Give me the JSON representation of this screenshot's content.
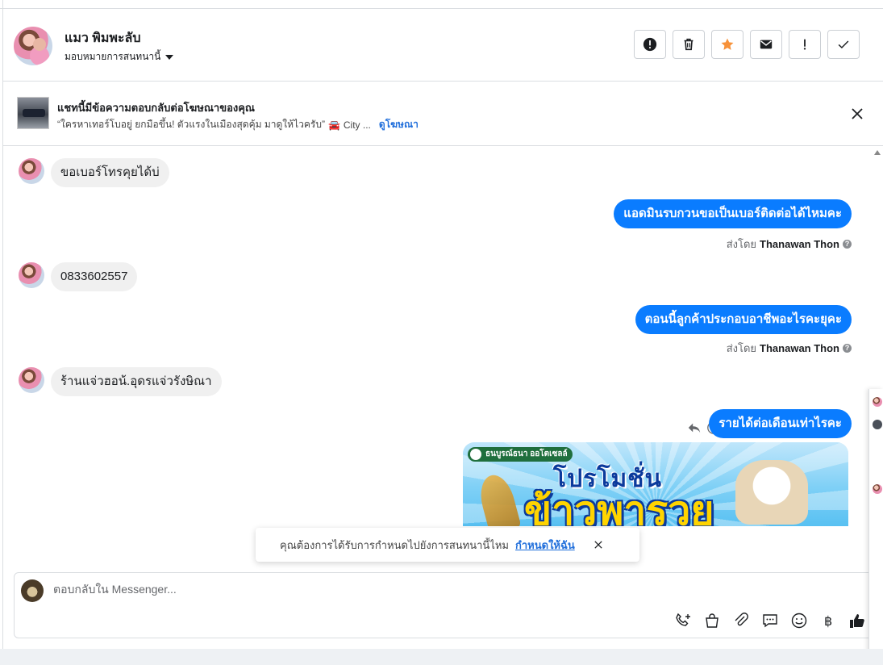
{
  "header": {
    "contact_name": "แมว พิมพะลับ",
    "assign_label": "มอบหมายการสนทนานี้",
    "actions": [
      "spam-report",
      "delete",
      "star",
      "mark-unread",
      "important",
      "done"
    ]
  },
  "ad_banner": {
    "title": "แชทนี้มีข้อความตอบกลับต่อโฆษณาของคุณ",
    "quote": "“ใครหาเทอร์โบอยู่ ยกมือขึ้น! ตัวแรงในเมืองสุดคุ้ม มาดูให้ไวครับ”",
    "emoji": "🚘",
    "suffix": "City ...",
    "link": "ดูโฆษณา"
  },
  "messages": [
    {
      "side": "in",
      "text": "ขอเบอร์โทรคุยได้บ่"
    },
    {
      "side": "out",
      "text": "แอดมินรบกวนขอเป็นเบอร์ติดต่อได้ไหมคะ",
      "sent_by_prefix": "ส่งโดย",
      "sent_by_name": "Thanawan Thon"
    },
    {
      "side": "in",
      "text": "0833602557"
    },
    {
      "side": "out",
      "text": "ตอนนี้ลูกค้าประกอบอาชีพอะไรคะยุคะ",
      "sent_by_prefix": "ส่งโดย",
      "sent_by_name": "Thanawan Thon"
    },
    {
      "side": "in",
      "text": "ร้านแจ่วฮอน้.อุดรแจ่วรังษิณา"
    },
    {
      "side": "out",
      "text": "รายได้ต่อเดือนเท่าไรคะ"
    }
  ],
  "promo": {
    "brand": "ธนบูรณ์ธนา ออโตเซลล์",
    "line1": "โปรโมชั่น",
    "line2": "ข้าวพารวย"
  },
  "toast": {
    "text": "คุณต้องการได้รับการกำหนดไปยังการสนทนานี้ไหม",
    "link": "กำหนดให้ฉัน"
  },
  "composer": {
    "placeholder": "ตอบกลับใน Messenger...",
    "tools": [
      "call-add",
      "shopping-bag",
      "attachment",
      "saved-replies",
      "emoji",
      "payment",
      "like"
    ]
  },
  "colors": {
    "outgoing": "#0a7cff",
    "incoming": "#f0f0f0",
    "link": "#216fdb",
    "star": "#f7923a"
  }
}
